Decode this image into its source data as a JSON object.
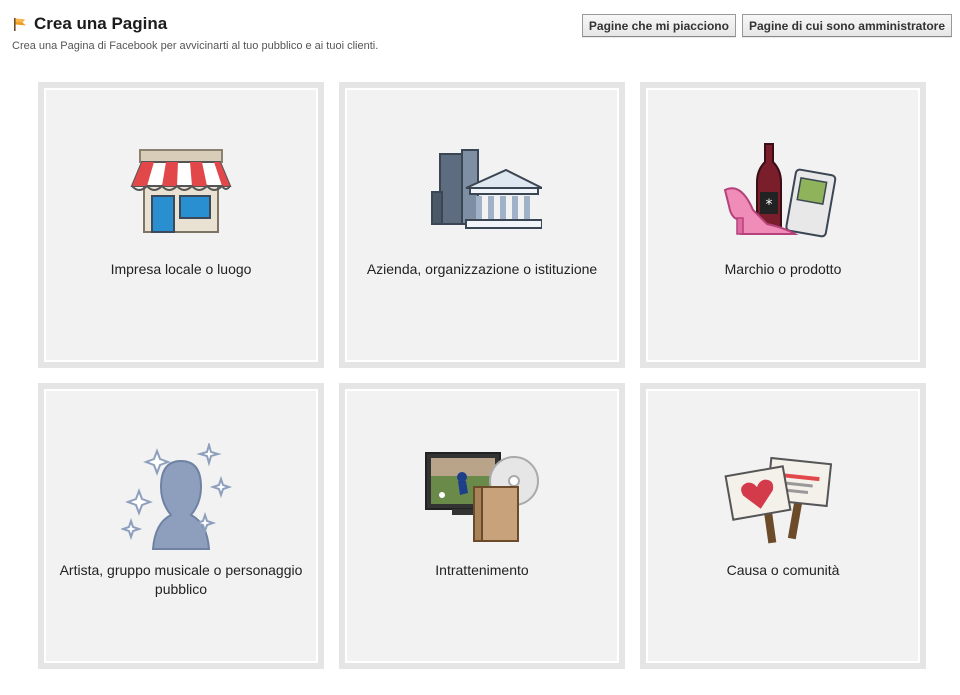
{
  "header": {
    "title": "Crea una Pagina",
    "subtitle": "Crea una Pagina di Facebook per avvicinarti al tuo pubblico e ai tuoi clienti."
  },
  "buttons": {
    "liked_pages": "Pagine che mi piacciono",
    "admin_pages": "Pagine di cui sono amministratore"
  },
  "categories": [
    {
      "label": "Impresa locale o luogo",
      "icon": "storefront-icon"
    },
    {
      "label": "Azienda, organizzazione o istituzione",
      "icon": "buildings-icon"
    },
    {
      "label": "Marchio o prodotto",
      "icon": "products-icon"
    },
    {
      "label": "Artista, gruppo musicale o personaggio pubblico",
      "icon": "star-silhouette-icon"
    },
    {
      "label": "Intrattenimento",
      "icon": "entertainment-icon"
    },
    {
      "label": "Causa o comunità",
      "icon": "protest-signs-icon"
    }
  ],
  "colors": {
    "card_bg": "#f2f2f2",
    "card_border": "#e5e5e5",
    "button_border": "#999999"
  }
}
